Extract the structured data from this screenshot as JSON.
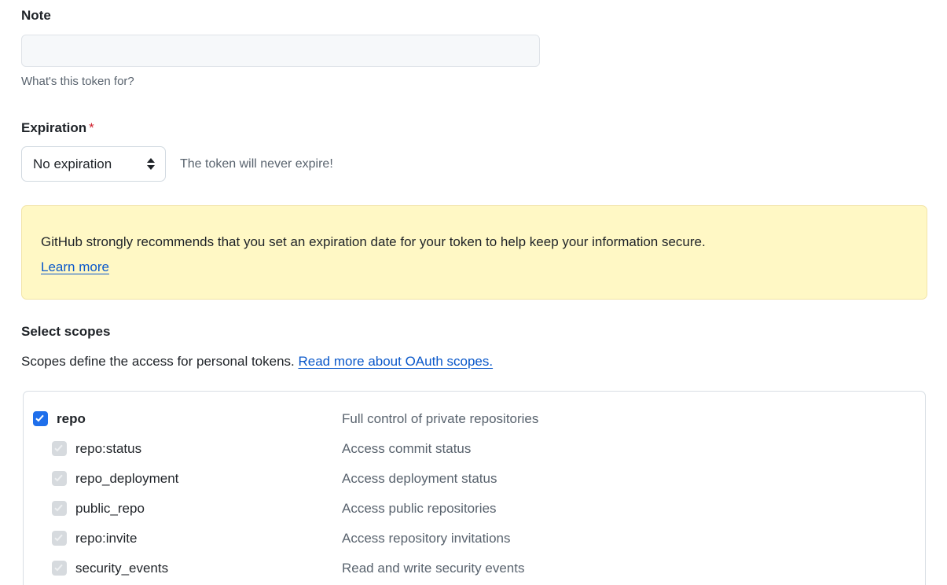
{
  "note": {
    "label": "Note",
    "value": "",
    "placeholder": "",
    "help": "What's this token for?"
  },
  "expiration": {
    "label": "Expiration",
    "required_mark": "*",
    "selected": "No expiration",
    "options": [
      "No expiration"
    ],
    "note": "The token will never expire!"
  },
  "warning": {
    "text": "GitHub strongly recommends that you set an expiration date for your token to help keep your information secure.",
    "link_label": "Learn more",
    "background": "#fff8c5",
    "border": "#f2e4a8"
  },
  "scopes": {
    "title": "Select scopes",
    "description": "Scopes define the access for personal tokens.",
    "description_link": "Read more about OAuth scopes.",
    "accent_checked": "#1f6feb",
    "accent_disabled": "#d6dade",
    "rows": [
      {
        "name": "repo",
        "description": "Full control of private repositories",
        "level": "parent",
        "checked": true,
        "disabled": false
      },
      {
        "name": "repo:status",
        "description": "Access commit status",
        "level": "child",
        "checked": true,
        "disabled": true
      },
      {
        "name": "repo_deployment",
        "description": "Access deployment status",
        "level": "child",
        "checked": true,
        "disabled": true
      },
      {
        "name": "public_repo",
        "description": "Access public repositories",
        "level": "child",
        "checked": true,
        "disabled": true
      },
      {
        "name": "repo:invite",
        "description": "Access repository invitations",
        "level": "child",
        "checked": true,
        "disabled": true
      },
      {
        "name": "security_events",
        "description": "Read and write security events",
        "level": "child",
        "checked": true,
        "disabled": true
      }
    ]
  }
}
